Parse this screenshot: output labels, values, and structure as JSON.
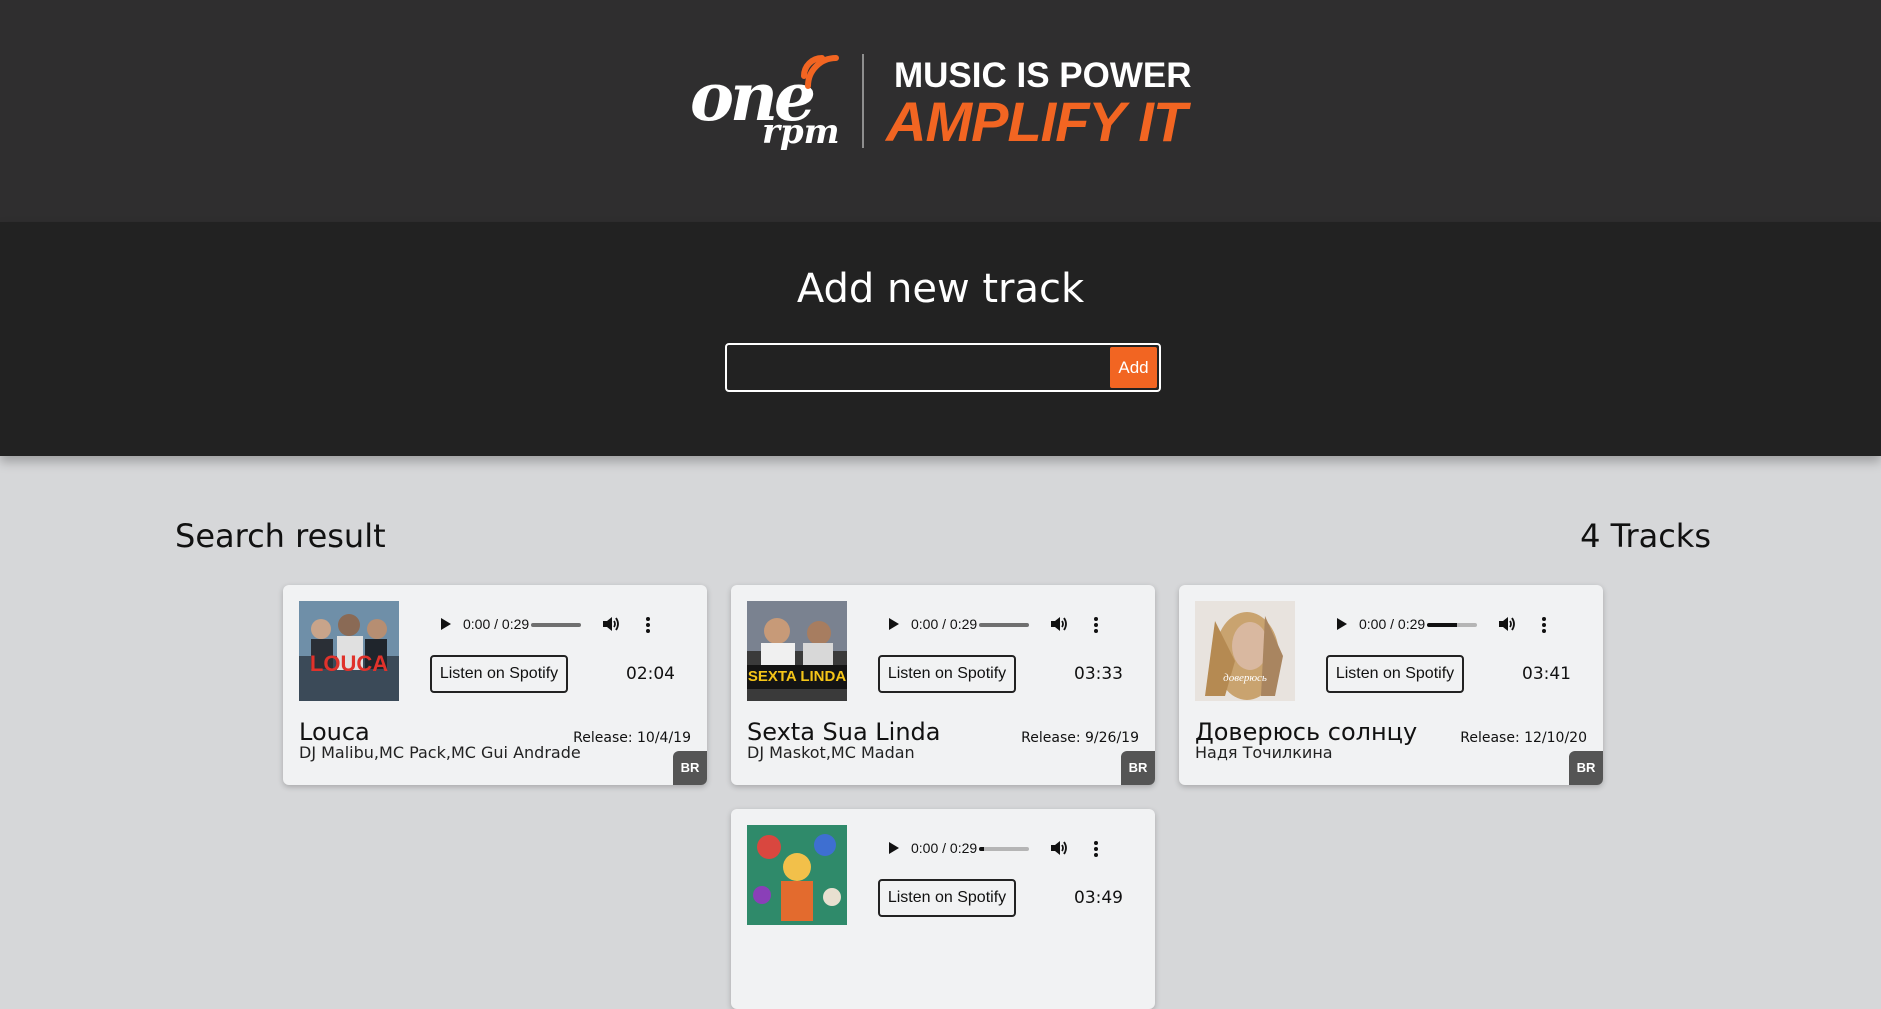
{
  "header": {
    "brand": {
      "name": "one",
      "sub": "rpm"
    },
    "tagline_line1": "MUSIC IS POWER",
    "tagline_line2": "AMPLIFY IT",
    "accent_color": "#f26522"
  },
  "add_track": {
    "title": "Add new track",
    "input_value": "",
    "button_label": "Add"
  },
  "results": {
    "title": "Search result",
    "count_label": "4 Tracks"
  },
  "tracks": [
    {
      "title": "Louca",
      "artists": "DJ Malibu,MC Pack,MC Gui Andrade",
      "release": "Release: 10/4/19",
      "duration": "02:04",
      "player_time": "0:00 / 0:29",
      "volume_level": 0,
      "spotify_label": "Listen on Spotify",
      "country": "BR",
      "cover_icon": "album-cover-image"
    },
    {
      "title": "Sexta Sua Linda",
      "artists": "DJ Maskot,MC Madan",
      "release": "Release: 9/26/19",
      "duration": "03:33",
      "player_time": "0:00 / 0:29",
      "volume_level": 0,
      "spotify_label": "Listen on Spotify",
      "country": "BR",
      "cover_icon": "album-cover-image"
    },
    {
      "title": "Доверюсь солнцу",
      "artists": "Надя Точилкина",
      "release": "Release: 12/10/20",
      "duration": "03:41",
      "player_time": "0:00 / 0:29",
      "volume_level": 0.6,
      "spotify_label": "Listen on Spotify",
      "country": "BR",
      "cover_icon": "album-cover-image"
    },
    {
      "title": "",
      "artists": "",
      "release": "",
      "duration": "03:49",
      "player_time": "0:00 / 0:29",
      "volume_level": 0.1,
      "spotify_label": "Listen on Spotify",
      "country": "",
      "cover_icon": "album-cover-image"
    }
  ]
}
